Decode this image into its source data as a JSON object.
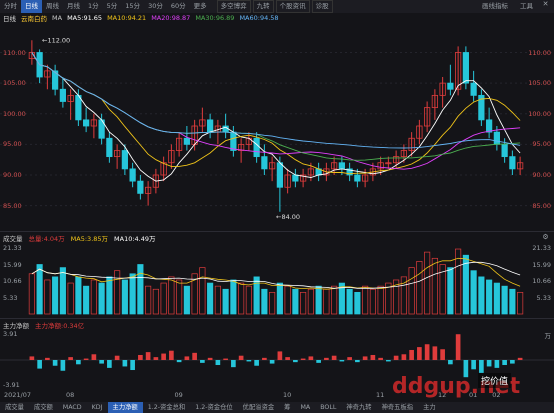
{
  "top_tabs": [
    "分时",
    "日线",
    "周线",
    "月线",
    "1分",
    "5分",
    "15分",
    "30分",
    "60分",
    "更多"
  ],
  "active_top_tab": "日线",
  "chips": [
    "多空博弈",
    "九转",
    "个股资讯",
    "诊股"
  ],
  "right_tools": [
    "画线指标",
    "工具"
  ],
  "stock_name": "云南白药",
  "period_label": "日线",
  "ma_labels": {
    "ma": "MA",
    "ma5": "MA5:91.65",
    "ma10": "MA10:94.21",
    "ma20": "MA20:98.87",
    "ma30": "MA30:96.89",
    "ma60": "MA60:94.58"
  },
  "colors": {
    "ma5": "#ffffff",
    "ma10": "#f0c419",
    "ma20": "#e040fb",
    "ma30": "#4caf50",
    "ma60": "#64b5f6",
    "up": "#e03c3c",
    "down": "#26c6da",
    "price_axis": "#d05050"
  },
  "price_axis": [
    "110.00",
    "105.00",
    "100.00",
    "95.00",
    "90.00",
    "85.00"
  ],
  "price_annotations": {
    "high": "112.00",
    "low": "84.00"
  },
  "volume_panel": {
    "title": "成交量",
    "total": "总量:4.04万",
    "ma5": "MA5:3.85万",
    "ma10": "MA10:4.49万",
    "axis": [
      "21.33",
      "15.99",
      "10.66",
      "5.33"
    ],
    "unit": "万",
    "left_axis": [
      "21.33",
      "15.99",
      "10.66",
      "5.33"
    ]
  },
  "flow_panel": {
    "title": "主力净额",
    "value": "主力净额:0.34亿",
    "axis_top": "3.91",
    "axis_bottom": "-3.91",
    "unit": "万"
  },
  "date_axis": [
    "2021/07",
    "08",
    "09",
    "10",
    "11",
    "12",
    "01",
    "02"
  ],
  "bottom_tabs": [
    "成交量",
    "成交额",
    "MACD",
    "KDJ",
    "主力净额",
    "1.2-资金总和",
    "1.2-资金仓位",
    "优配溢资金",
    "筹",
    "MA",
    "BOLL",
    "神奇九转",
    "神奇五板指",
    "主力"
  ],
  "active_bottom_tab": "主力净额",
  "watermark": "ddgup.net",
  "watermark_brand": "挖价值",
  "chart_data": {
    "type": "candlestick",
    "ylim": [
      82,
      114
    ],
    "candles": [
      [
        109,
        112,
        108,
        110
      ],
      [
        110,
        110.5,
        105,
        106
      ],
      [
        106,
        108,
        104,
        107
      ],
      [
        107,
        108,
        103,
        104
      ],
      [
        104,
        106,
        101,
        102
      ],
      [
        102,
        104,
        99,
        103
      ],
      [
        103,
        104,
        98,
        99
      ],
      [
        99,
        101,
        97,
        98
      ],
      [
        98,
        100,
        96,
        99
      ],
      [
        99,
        100,
        95,
        96
      ],
      [
        96,
        97,
        92,
        93
      ],
      [
        93,
        95,
        91,
        94
      ],
      [
        94,
        95,
        90,
        91
      ],
      [
        91,
        92,
        88,
        89
      ],
      [
        89,
        90,
        86,
        87
      ],
      [
        87,
        89,
        85,
        88
      ],
      [
        88,
        91,
        87,
        90
      ],
      [
        90,
        93,
        89,
        92
      ],
      [
        92,
        95,
        91,
        94
      ],
      [
        94,
        97,
        93,
        96
      ],
      [
        96,
        98,
        94,
        95
      ],
      [
        95,
        99,
        94,
        98
      ],
      [
        98,
        101,
        97,
        99
      ],
      [
        99,
        100,
        96,
        97
      ],
      [
        97,
        99,
        95,
        98
      ],
      [
        98,
        100,
        96,
        97
      ],
      [
        97,
        98,
        93,
        94
      ],
      [
        94,
        96,
        92,
        95
      ],
      [
        95,
        97,
        94,
        96
      ],
      [
        96,
        97,
        92,
        93
      ],
      [
        93,
        95,
        90,
        91
      ],
      [
        91,
        93,
        89,
        92
      ],
      [
        92,
        93,
        84,
        88
      ],
      [
        88,
        91,
        87,
        90
      ],
      [
        90,
        91,
        88,
        89
      ],
      [
        89,
        91,
        88,
        90
      ],
      [
        90,
        92,
        89,
        91
      ],
      [
        91,
        92,
        89,
        90
      ],
      [
        90,
        92,
        89,
        91
      ],
      [
        91,
        93,
        90,
        92
      ],
      [
        92,
        93,
        90,
        91
      ],
      [
        91,
        92,
        89,
        90
      ],
      [
        90,
        91,
        88,
        89
      ],
      [
        89,
        91,
        88,
        90
      ],
      [
        90,
        92,
        89,
        91
      ],
      [
        91,
        93,
        90,
        92
      ],
      [
        92,
        93,
        91,
        92
      ],
      [
        92,
        94,
        91,
        93
      ],
      [
        93,
        95,
        92,
        94
      ],
      [
        94,
        97,
        93,
        96
      ],
      [
        96,
        99,
        95,
        98
      ],
      [
        98,
        102,
        97,
        101
      ],
      [
        101,
        104,
        99,
        103
      ],
      [
        103,
        106,
        101,
        105
      ],
      [
        105,
        108,
        103,
        104
      ],
      [
        104,
        111,
        103,
        110
      ],
      [
        110,
        111,
        104,
        105
      ],
      [
        105,
        107,
        102,
        103
      ],
      [
        103,
        104,
        98,
        99
      ],
      [
        99,
        101,
        96,
        97
      ],
      [
        97,
        98,
        94,
        95
      ],
      [
        95,
        96,
        92,
        93
      ],
      [
        93,
        94,
        90,
        91
      ],
      [
        91,
        93,
        90,
        92
      ]
    ],
    "volume": [
      13,
      16,
      11,
      12,
      15,
      10,
      12,
      9,
      11,
      10,
      12,
      14,
      11,
      13,
      16,
      9,
      8,
      10,
      12,
      11,
      9,
      13,
      15,
      10,
      9,
      8,
      11,
      10,
      9,
      12,
      8,
      7,
      10,
      9,
      8,
      7,
      8,
      9,
      8,
      9,
      10,
      8,
      7,
      9,
      8,
      9,
      10,
      11,
      12,
      15,
      17,
      20,
      18,
      16,
      15,
      21,
      19,
      14,
      12,
      11,
      10,
      9,
      8,
      7
    ],
    "flow": [
      0.5,
      -1.2,
      0.3,
      -0.8,
      -1.5,
      0.4,
      -0.6,
      0.2,
      0.8,
      -0.5,
      -1.1,
      0.6,
      -0.9,
      -1.4,
      0.7,
      1.1,
      0.4,
      0.9,
      1.3,
      -0.3,
      0.5,
      1.0,
      -0.4,
      0.3,
      -0.7,
      0.2,
      -1.0,
      0.6,
      -0.2,
      -0.8,
      0.3,
      -0.5,
      1.2,
      0.4,
      -0.3,
      0.2,
      0.5,
      -0.4,
      0.3,
      0.6,
      -0.2,
      0.4,
      -0.3,
      0.5,
      0.7,
      0.3,
      -0.2,
      0.6,
      0.8,
      1.4,
      1.8,
      2.2,
      1.9,
      1.5,
      -0.6,
      3.6,
      -2.4,
      -1.3,
      -1.8,
      -0.9,
      -1.1,
      -0.7,
      -0.5,
      0.3
    ]
  }
}
